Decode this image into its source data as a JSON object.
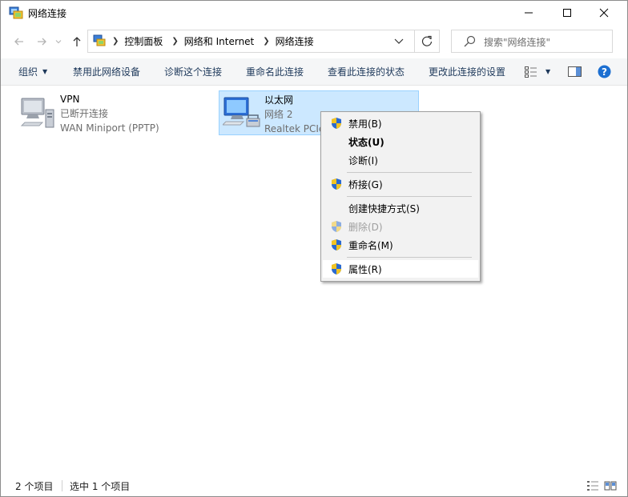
{
  "window": {
    "title": "网络连接",
    "controls": [
      "minimize",
      "maximize",
      "close"
    ]
  },
  "navigation": {
    "breadcrumbs": [
      "控制面板",
      "网络和 Internet",
      "网络连接"
    ],
    "search_placeholder": "搜索\"网络连接\""
  },
  "toolbar": {
    "organize_label": "组织",
    "items": [
      "禁用此网络设备",
      "诊断这个连接",
      "重命名此连接",
      "查看此连接的状态",
      "更改此连接的设置"
    ]
  },
  "connections": [
    {
      "name": "VPN",
      "status": "已断开连接",
      "device": "WAN Miniport (PPTP)",
      "selected": false
    },
    {
      "name": "以太网",
      "status": "网络 2",
      "device": "Realtek PCIe",
      "selected": true
    }
  ],
  "context_menu": {
    "items": [
      {
        "label": "禁用(B)",
        "shield": true,
        "bold": false,
        "disabled": false
      },
      {
        "label": "状态(U)",
        "shield": false,
        "bold": true,
        "disabled": false
      },
      {
        "label": "诊断(I)",
        "shield": false,
        "bold": false,
        "disabled": false
      },
      {
        "label": "桥接(G)",
        "shield": true,
        "bold": false,
        "disabled": false
      },
      {
        "label": "创建快捷方式(S)",
        "shield": false,
        "bold": false,
        "disabled": false
      },
      {
        "label": "删除(D)",
        "shield": true,
        "bold": false,
        "disabled": true
      },
      {
        "label": "重命名(M)",
        "shield": true,
        "bold": false,
        "disabled": false
      },
      {
        "label": "属性(R)",
        "shield": true,
        "bold": false,
        "disabled": false,
        "hovered": true
      }
    ]
  },
  "statusbar": {
    "item_count": "2 个项目",
    "selected_count": "选中 1 个项目"
  },
  "colors": {
    "selection_bg": "#cce8ff",
    "selection_border": "#99d1ff",
    "toolbar_text": "#1e395b",
    "help_blue": "#1c6fd1"
  }
}
